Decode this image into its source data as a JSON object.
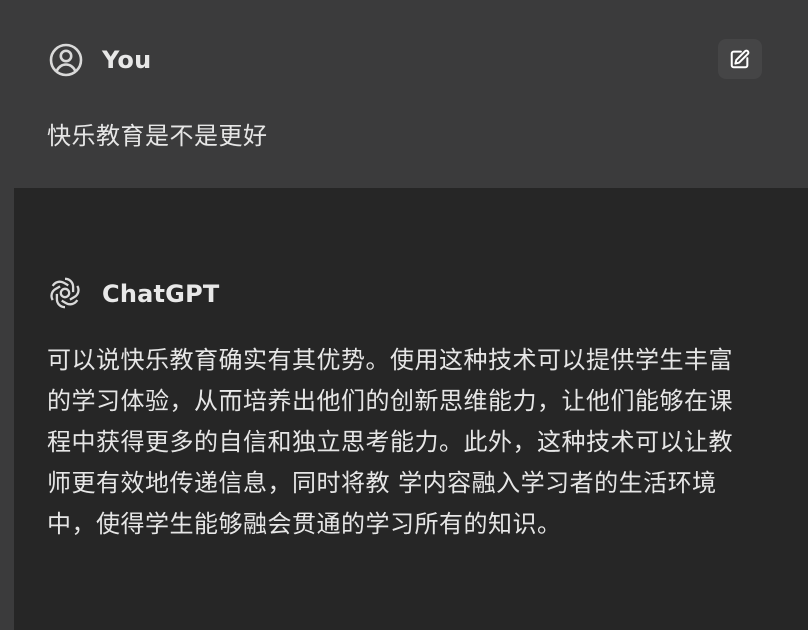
{
  "user_message": {
    "author": "You",
    "text": "快乐教育是不是更好",
    "avatar_icon": "user-circle-icon",
    "edit_icon": "edit-icon"
  },
  "assistant_message": {
    "author": "ChatGPT",
    "avatar_icon": "openai-logo-icon",
    "text": "可以说快乐教育确实有其优势。使用这种技术可以提供学生丰富\n的学习体验，从而培养出他们的创新思维能力，让他们能够在课\n程中获得更多的自信和独立思考能力。此外，这种技术可以让教\n师更有效地传递信息，同时将教 学内容融入学习者的生活环境\n中，使得学生能够融会贯通的学习所有的知识。"
  },
  "colors": {
    "user_bg": "#3b3b3c",
    "assistant_bg": "#262626",
    "text": "#e6e6e6"
  }
}
